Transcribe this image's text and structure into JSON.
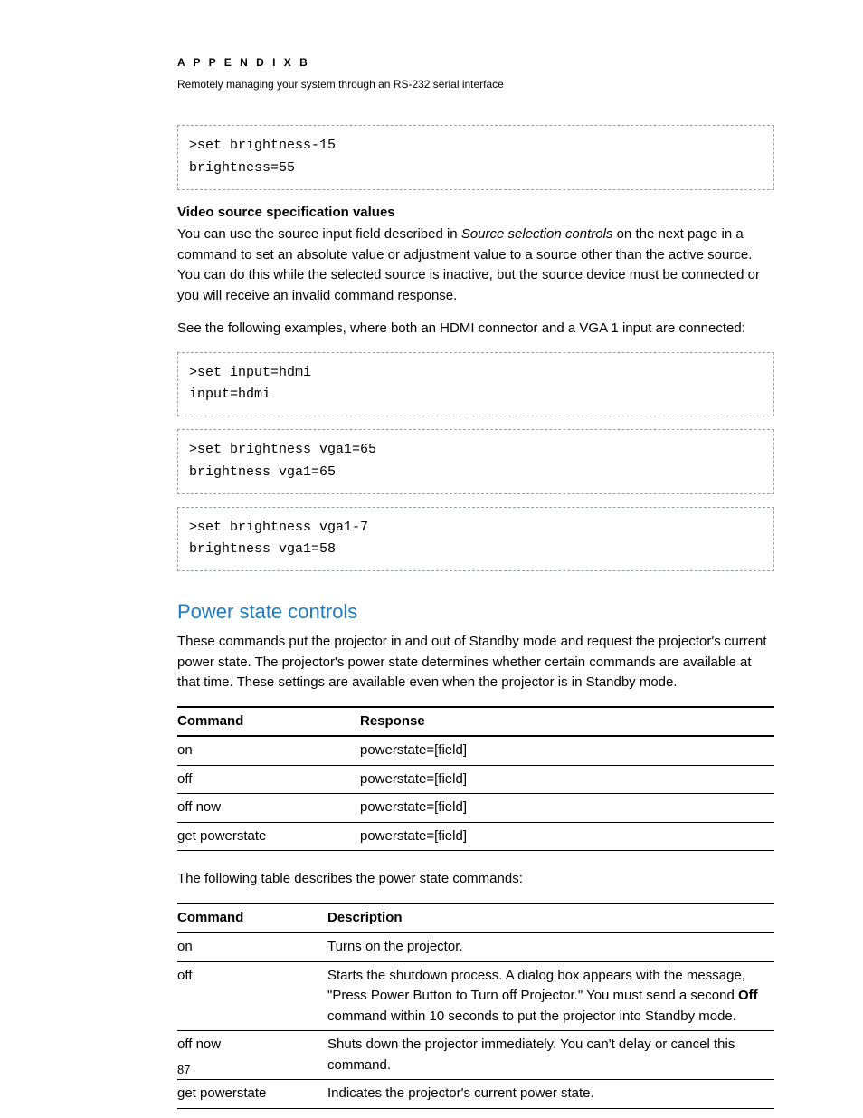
{
  "header": {
    "appendix": "A P P E N D I X   B",
    "subtitle": "Remotely managing your system through an RS-232 serial interface"
  },
  "code1": {
    "l1": ">set brightness-15",
    "l2": "brightness=55"
  },
  "vsv": {
    "heading": "Video source specification values",
    "p1a": "You can use the source input field described in ",
    "p1i": "Source selection controls",
    "p1b": "  on the next page in a command to set an absolute value or adjustment value to a source other than the active source. You can do this while the selected source is inactive, but the source device must be connected or you will receive an invalid command response.",
    "p2": "See the following examples, where both an HDMI connector and a VGA 1 input are connected:"
  },
  "code2": {
    "l1": ">set input=hdmi",
    "l2": "input=hdmi"
  },
  "code3": {
    "l1": ">set brightness vga1=65",
    "l2": "brightness vga1=65"
  },
  "code4": {
    "l1": ">set brightness vga1-7",
    "l2": "brightness vga1=58"
  },
  "psc": {
    "title": "Power state controls",
    "intro": "These commands put the projector in and out of Standby mode and request the projector's current power state. The projector's power state determines whether certain commands are available at that time. These settings are available even when the projector is in Standby mode.",
    "table1": {
      "h1": "Command",
      "h2": "Response",
      "rows": [
        {
          "c": "on",
          "r": "powerstate=[field]"
        },
        {
          "c": "off",
          "r": "powerstate=[field]"
        },
        {
          "c": "off now",
          "r": "powerstate=[field]"
        },
        {
          "c": "get powerstate",
          "r": "powerstate=[field]"
        }
      ]
    },
    "p2": "The following table describes the power state commands:",
    "table2": {
      "h1": "Command",
      "h2": "Description",
      "rows": [
        {
          "c": "on",
          "d": "Turns on the projector."
        },
        {
          "c": "off",
          "d_a": "Starts the shutdown process. A dialog box appears with the message, \"Press Power Button to Turn off Projector.\" You must send a second ",
          "d_b": "Off",
          "d_c": " command within 10 seconds to put the projector into Standby mode."
        },
        {
          "c": "off now",
          "d": "Shuts down the projector immediately. You can't delay or cancel this command."
        },
        {
          "c": "get powerstate",
          "d": "Indicates the projector's current power state."
        }
      ]
    }
  },
  "page_number": "87"
}
